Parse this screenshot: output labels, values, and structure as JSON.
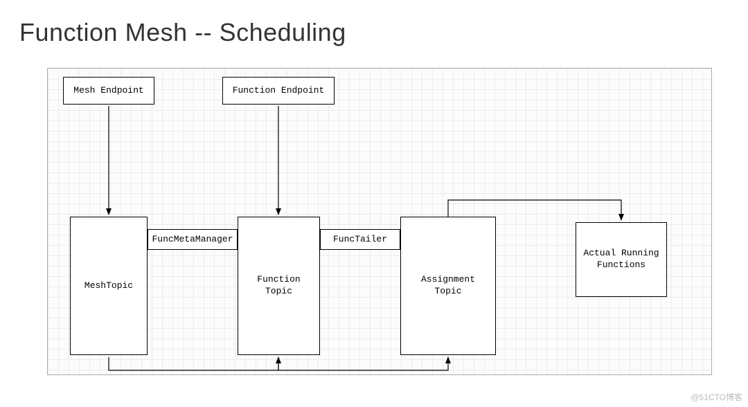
{
  "title": "Function Mesh -- Scheduling",
  "watermark": "@51CTO博客",
  "boxes": {
    "mesh_endpoint": "Mesh Endpoint",
    "function_endpoint": "Function Endpoint",
    "func_meta_manager": "FuncMetaManager",
    "func_tailer": "FuncTailer",
    "mesh_topic": "MeshTopic",
    "function_topic": "Function\nTopic",
    "assignment_topic": "Assignment\nTopic",
    "actual_running_functions": "Actual Running\nFunctions"
  },
  "diagram_meta": {
    "type": "flow-diagram",
    "nodes": [
      "Mesh Endpoint",
      "Function Endpoint",
      "FuncMetaManager",
      "FuncTailer",
      "MeshTopic",
      "Function Topic",
      "Assignment Topic",
      "Actual Running Functions"
    ],
    "edges": [
      {
        "from": "Mesh Endpoint",
        "to": "MeshTopic",
        "style": "arrow"
      },
      {
        "from": "Function Endpoint",
        "to": "Function Topic",
        "style": "arrow"
      },
      {
        "from": "FuncMetaManager",
        "to": "MeshTopic",
        "style": "line-left"
      },
      {
        "from": "FuncMetaManager",
        "to": "Function Topic",
        "style": "line-right"
      },
      {
        "from": "FuncTailer",
        "to": "Function Topic",
        "style": "line-left"
      },
      {
        "from": "FuncTailer",
        "to": "Assignment Topic",
        "style": "line-right"
      },
      {
        "from": "MeshTopic",
        "to": "Function Topic",
        "style": "arrow-bottom"
      },
      {
        "from": "Function Topic",
        "to": "Assignment Topic",
        "style": "arrow-bottom"
      },
      {
        "from": "Assignment Topic",
        "to": "Actual Running Functions",
        "style": "arrow-top"
      }
    ]
  }
}
